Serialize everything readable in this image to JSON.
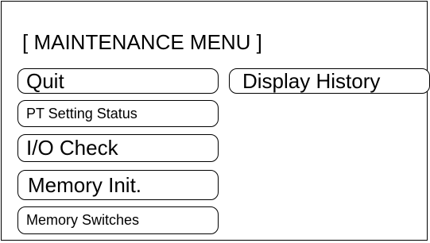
{
  "menu": {
    "title": "[ MAINTENANCE MENU ]",
    "buttons": {
      "quit": "Quit",
      "display_history": "Display History",
      "pt_setting_status": "PT Setting Status",
      "io_check": "I/O Check",
      "memory_init": "Memory Init.",
      "memory_switches": "Memory Switches"
    }
  },
  "colors": {
    "background": "#ffffff",
    "foreground": "#000000"
  }
}
